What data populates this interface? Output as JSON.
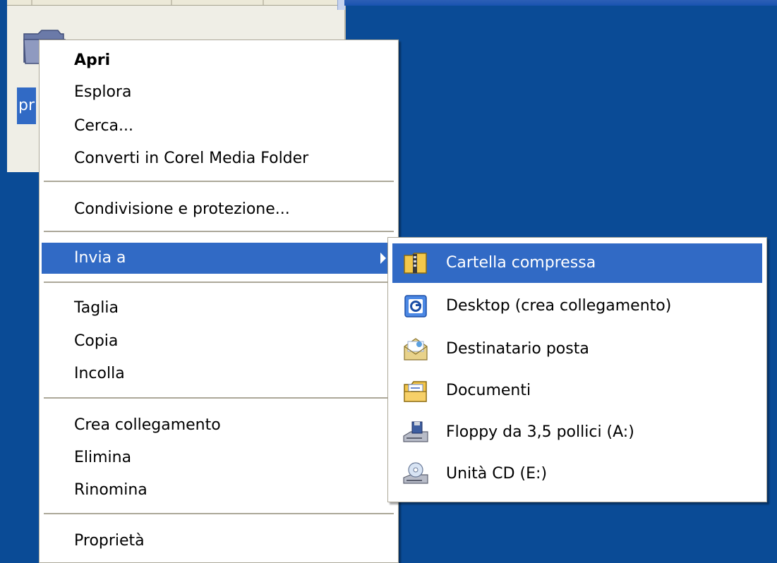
{
  "desktop": {
    "icon": {
      "label": "pr",
      "icon": "folder-icon"
    }
  },
  "context_menu": {
    "items": [
      {
        "label": "Apri",
        "default": true
      },
      {
        "label": "Esplora"
      },
      {
        "label": "Cerca..."
      },
      {
        "label": "Converti in Corel Media Folder"
      },
      {
        "label": "Condivisione e protezione..."
      },
      {
        "label": "Invia a",
        "has_submenu": true,
        "highlighted": true
      },
      {
        "label": "Taglia"
      },
      {
        "label": "Copia"
      },
      {
        "label": "Incolla"
      },
      {
        "label": "Crea collegamento"
      },
      {
        "label": "Elimina"
      },
      {
        "label": "Rinomina"
      },
      {
        "label": "Proprietà"
      }
    ]
  },
  "send_to_submenu": {
    "items": [
      {
        "label": "Cartella compressa",
        "icon": "zip-folder-icon",
        "highlighted": true
      },
      {
        "label": "Desktop (crea collegamento)",
        "icon": "desktop-shortcut-icon"
      },
      {
        "label": "Destinatario posta",
        "icon": "mail-recipient-icon"
      },
      {
        "label": "Documenti",
        "icon": "documents-folder-icon"
      },
      {
        "label": "Floppy da 3,5 pollici (A:)",
        "icon": "floppy-drive-icon"
      },
      {
        "label": "Unità CD (E:)",
        "icon": "cd-drive-icon"
      }
    ]
  },
  "colors": {
    "desktop": "#0a4b96",
    "highlight": "#316ac5",
    "menu_bg": "#ffffff",
    "separator": "#aca899"
  }
}
